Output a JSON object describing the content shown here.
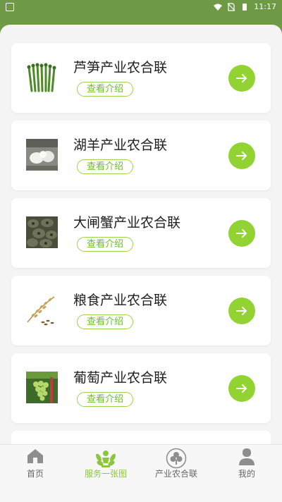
{
  "status_bar": {
    "time": "11:17"
  },
  "cards": [
    {
      "title": "芦笋产业农合联",
      "button_label": "查看介绍",
      "thumb": "asparagus"
    },
    {
      "title": "湖羊产业农合联",
      "button_label": "查看介绍",
      "thumb": "sheep"
    },
    {
      "title": "大闸蟹产业农合联",
      "button_label": "查看介绍",
      "thumb": "crab"
    },
    {
      "title": "粮食产业农合联",
      "button_label": "查看介绍",
      "thumb": "rice"
    },
    {
      "title": "葡萄产业农合联",
      "button_label": "查看介绍",
      "thumb": "grape"
    }
  ],
  "tabs": [
    {
      "label": "首页",
      "icon": "home-icon",
      "active": false
    },
    {
      "label": "服务一张图",
      "icon": "service-map-icon",
      "active": true
    },
    {
      "label": "产业农合联",
      "icon": "clover-icon",
      "active": false
    },
    {
      "label": "我的",
      "icon": "user-icon",
      "active": false
    }
  ],
  "colors": {
    "header": "#6f9a45",
    "accent": "#92d233",
    "active_tab": "#8cc63f"
  }
}
